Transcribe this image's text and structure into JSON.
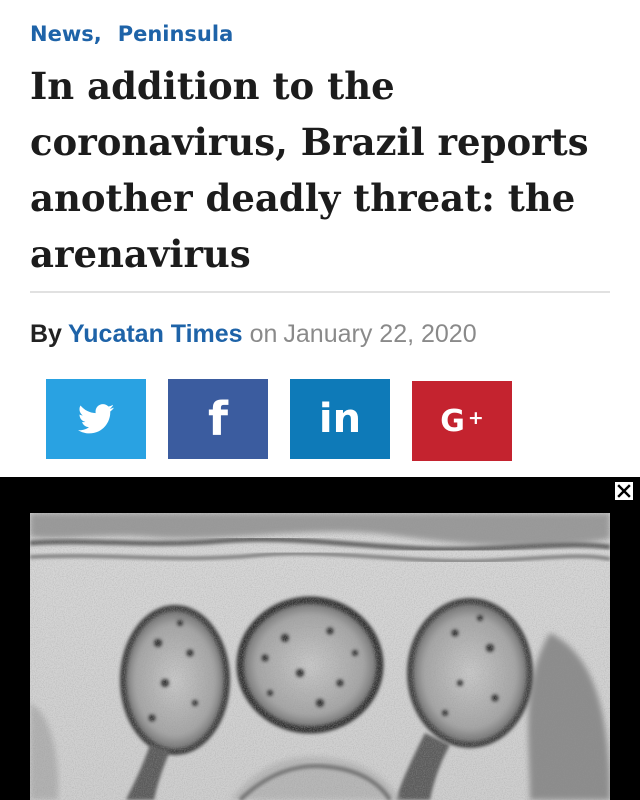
{
  "categories": [
    "News",
    "Peninsula"
  ],
  "category_separator": ",",
  "headline": "In addition to the coronavirus, Brazil reports another deadly threat: the arenavirus",
  "byline": {
    "by": "By",
    "author": "Yucatan Times",
    "on": "on",
    "date": "January 22, 2020"
  },
  "share_buttons": [
    {
      "network": "twitter",
      "icon": "twitter-bird-icon",
      "color": "#29a2e2"
    },
    {
      "network": "facebook",
      "icon": "facebook-f-icon",
      "glyph": "f",
      "color": "#3b5c9f"
    },
    {
      "network": "linkedin",
      "icon": "linkedin-in-icon",
      "glyph": "in",
      "color": "#0e7ab8"
    },
    {
      "network": "google-plus",
      "icon": "google-plus-icon",
      "glyph": "G",
      "plus": "+",
      "color": "#c4232f"
    }
  ],
  "ad": {
    "close_icon": "close-icon",
    "image": "arenavirus-electron-micrograph"
  },
  "colors": {
    "link_blue": "#1e63a8",
    "headline": "#1c1c1c",
    "meta_gray": "#8a8a8a"
  }
}
